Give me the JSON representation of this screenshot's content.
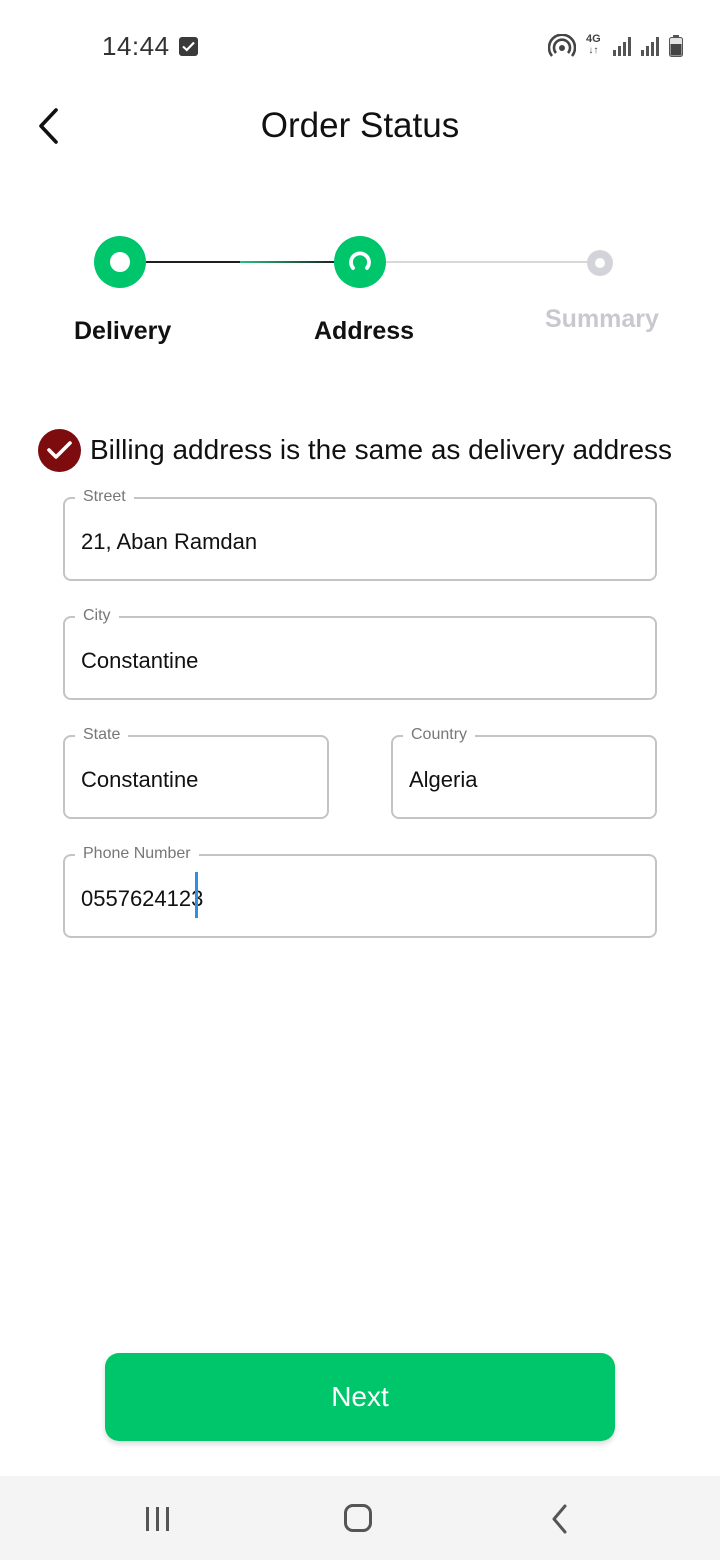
{
  "status_bar": {
    "time": "14:44",
    "network": "4G",
    "icons": [
      "notification-check-icon",
      "hotspot-icon",
      "signal-icon",
      "signal-icon",
      "battery-icon"
    ]
  },
  "header": {
    "title": "Order Status",
    "back_icon": "back-arrow-icon"
  },
  "stepper": {
    "steps": [
      {
        "label": "Delivery",
        "state": "completed"
      },
      {
        "label": "Address",
        "state": "active"
      },
      {
        "label": "Summary",
        "state": "pending"
      }
    ],
    "active_color": "#00c66b",
    "pending_color": "#c8c9cf"
  },
  "billing": {
    "checked": true,
    "label": "Billing address is the same as delivery address",
    "check_color": "#7c0c0e"
  },
  "form": {
    "street": {
      "label": "Street",
      "value": "21, Aban Ramdan"
    },
    "city": {
      "label": "City",
      "value": "Constantine"
    },
    "state": {
      "label": "State",
      "value": "Constantine"
    },
    "country": {
      "label": "Country",
      "value": "Algeria"
    },
    "phone": {
      "label": "Phone Number",
      "value": "0557624123"
    }
  },
  "actions": {
    "next_label": "Next",
    "next_color": "#00c66b"
  },
  "nav_bar": {
    "icons": [
      "recent-apps-icon",
      "home-icon",
      "back-icon"
    ]
  }
}
